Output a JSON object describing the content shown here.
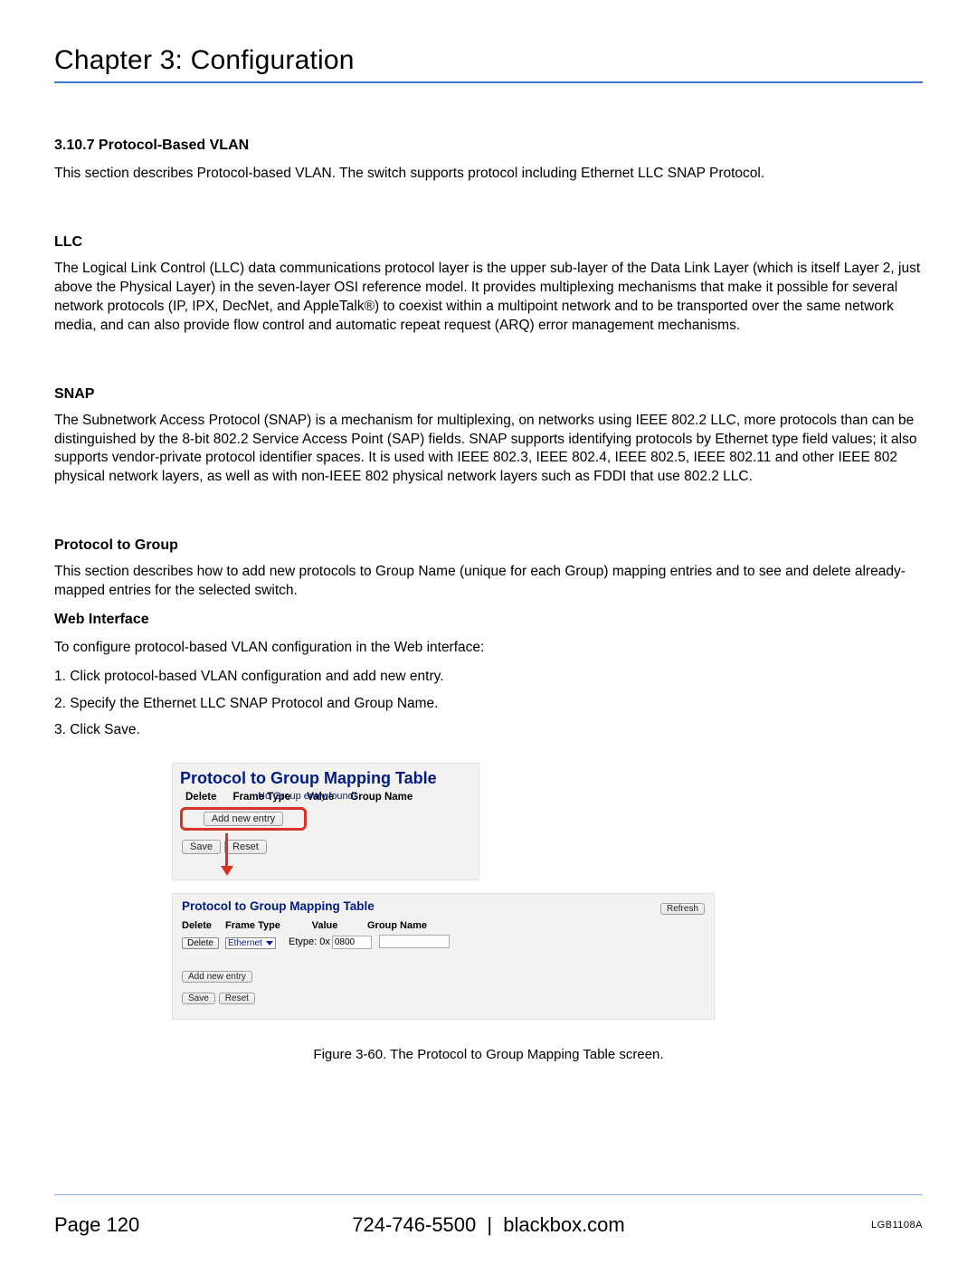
{
  "chapter": "Chapter 3: Configuration",
  "section": {
    "number_title": "3.10.7 Protocol-Based VLAN",
    "intro": "This section describes Protocol-based VLAN. The switch supports protocol including Ethernet LLC SNAP Protocol."
  },
  "llc": {
    "heading": "LLC",
    "text": "The Logical Link Control (LLC) data communications protocol layer is the upper sub-layer of the Data Link Layer (which is itself Layer 2, just above the Physical Layer) in the seven-layer OSI reference model. It provides multiplexing mechanisms that make it possible for several network protocols (IP, IPX, DecNet, and AppleTalk®) to coexist within a multipoint network and to be transported over the same network media, and can also provide flow control and automatic repeat request (ARQ) error management mechanisms."
  },
  "snap": {
    "heading": "SNAP",
    "text": "The Subnetwork Access Protocol (SNAP) is a mechanism for multiplexing, on networks using IEEE 802.2 LLC, more protocols than can be distinguished by the 8-bit 802.2 Service Access Point (SAP) fields. SNAP supports identifying protocols by Ethernet type field values; it also supports vendor-private protocol identifier spaces. It is used with IEEE 802.3, IEEE 802.4, IEEE 802.5, IEEE 802.11 and other IEEE 802 physical network layers, as well as with non-IEEE 802 physical network layers such as FDDI that use 802.2 LLC."
  },
  "p2g": {
    "heading": "Protocol to Group",
    "text": "This section describes how to add new protocols to Group Name (unique for each Group) mapping entries and to see and delete already-mapped entries for the selected switch."
  },
  "web": {
    "heading": "Web Interface",
    "intro": "To configure protocol-based VLAN configuration in the Web interface:",
    "steps": [
      "1. Click protocol-based VLAN configuration and add new entry.",
      "2. Specify the Ethernet LLC SNAP Protocol and Group Name.",
      "3. Click Save."
    ]
  },
  "panel1": {
    "title": "Protocol to Group Mapping Table",
    "cols": [
      "Delete",
      "Frame Type",
      "Value",
      "Group Name"
    ],
    "empty_msg": "No Group entry found!",
    "add_btn": "Add new entry",
    "save_btn": "Save",
    "reset_btn": "Reset"
  },
  "panel2": {
    "title": "Protocol to Group Mapping Table",
    "refresh": "Refresh",
    "cols": [
      "Delete",
      "Frame Type",
      "Value",
      "Group Name"
    ],
    "row": {
      "delete_btn": "Delete",
      "frametype_sel": "Ethernet",
      "etype_prefix": "Etype: 0x",
      "etype_val": "0800"
    },
    "add_btn": "Add new entry",
    "save_btn": "Save",
    "reset_btn": "Reset"
  },
  "caption": "Figure 3-60. The Protocol to Group Mapping Table screen.",
  "footer": {
    "page": "Page 120",
    "phone": "724-746-5500",
    "site": "blackbox.com",
    "model": "LGB1108A",
    "sep": "|"
  }
}
